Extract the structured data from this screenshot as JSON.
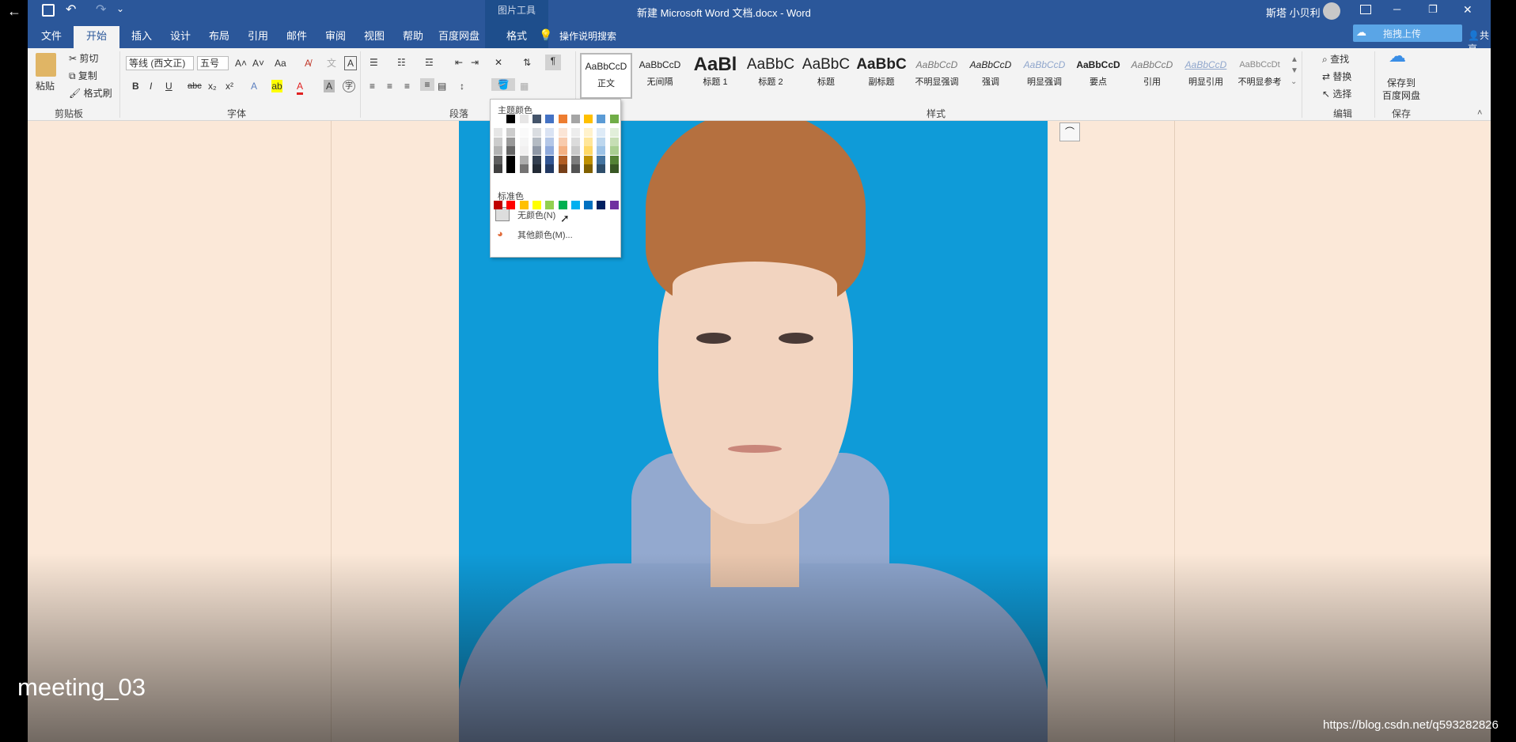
{
  "titlebar": {
    "context_label": "图片工具",
    "doc_title": "新建 Microsoft Word 文档.docx  -  Word",
    "user_name": "斯塔 小贝利",
    "upload_button": "拖拽上传",
    "share_label": "共享",
    "minimize": "─",
    "restore": "❐",
    "close": "✕"
  },
  "tabs": [
    {
      "label": "文件"
    },
    {
      "label": "开始"
    },
    {
      "label": "插入"
    },
    {
      "label": "设计"
    },
    {
      "label": "布局"
    },
    {
      "label": "引用"
    },
    {
      "label": "邮件"
    },
    {
      "label": "审阅"
    },
    {
      "label": "视图"
    },
    {
      "label": "帮助"
    },
    {
      "label": "百度网盘"
    },
    {
      "label": "格式"
    }
  ],
  "tellme": "操作说明搜索",
  "clipboard": {
    "paste": "粘贴",
    "cut": "剪切",
    "copy": "复制",
    "format_painter": "格式刷",
    "group": "剪贴板"
  },
  "font": {
    "name": "等线 (西文正)",
    "size": "五号",
    "bold": "B",
    "italic": "I",
    "underline": "U",
    "strike": "abc",
    "sub": "x₂",
    "sup": "x²",
    "grow": "A˄",
    "shrink": "A˅",
    "case": "Aa",
    "group": "字体"
  },
  "paragraph": {
    "group": "段落"
  },
  "styles": {
    "group": "样式",
    "items": [
      {
        "preview": "AaBbCcD",
        "name": "正文"
      },
      {
        "preview": "AaBbCcD",
        "name": "无间隔"
      },
      {
        "preview": "AaBl",
        "name": "标题 1"
      },
      {
        "preview": "AaBbC",
        "name": "标题 2"
      },
      {
        "preview": "AaBbC",
        "name": "标题"
      },
      {
        "preview": "AaBbC",
        "name": "副标题"
      },
      {
        "preview": "AaBbCcD",
        "name": "不明显强调"
      },
      {
        "preview": "AaBbCcD",
        "name": "强调"
      },
      {
        "preview": "AaBbCcD",
        "name": "明显强调"
      },
      {
        "preview": "AaBbCcD",
        "name": "要点"
      },
      {
        "preview": "AaBbCcD",
        "name": "引用"
      },
      {
        "preview": "AaBbCcD",
        "name": "明显引用"
      },
      {
        "preview": "AaBbCcDt",
        "name": "不明显参考"
      }
    ]
  },
  "editing": {
    "find": "查找",
    "replace": "替换",
    "select": "选择",
    "group": "编辑"
  },
  "save": {
    "label1": "保存到",
    "label2": "百度网盘",
    "group": "保存"
  },
  "dropdown": {
    "theme_header": "主题颜色",
    "standard_header": "标准色",
    "no_color": "无颜色(N)",
    "more_colors": "其他颜色(M)...",
    "theme_top": [
      "#ffffff",
      "#000000",
      "#e7e6e6",
      "#44546a",
      "#4472c4",
      "#ed7d31",
      "#a5a5a5",
      "#ffc000",
      "#5b9bd5",
      "#70ad47"
    ],
    "standard": [
      "#c00000",
      "#ff0000",
      "#ffc000",
      "#ffff00",
      "#92d050",
      "#00b050",
      "#00b0f0",
      "#0070c0",
      "#002060",
      "#7030a0"
    ]
  },
  "caption": "meeting_03",
  "watermark": "https://blog.csdn.net/q593282826",
  "colors": {
    "titlebar": "#2b579a",
    "photo_bg": "#0f9bd8",
    "page_bg": "#fbe8d8"
  }
}
